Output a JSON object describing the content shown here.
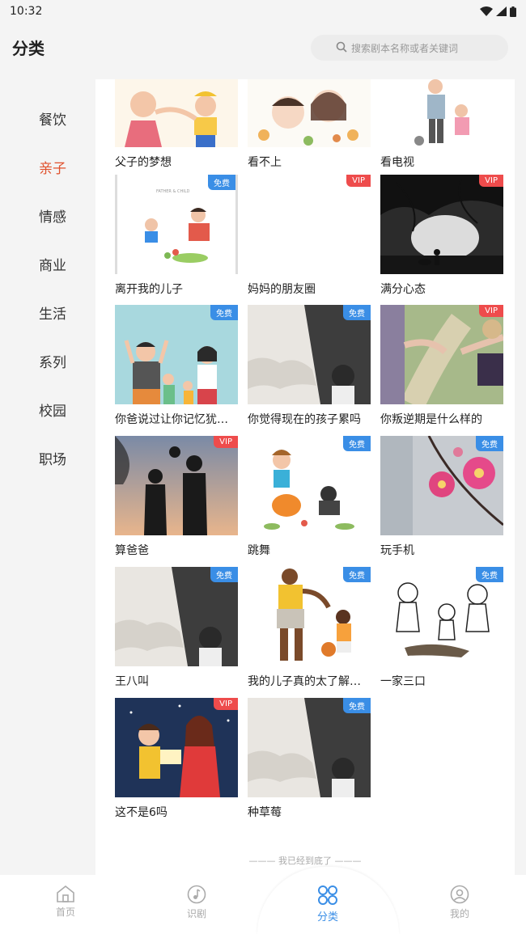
{
  "status_bar": {
    "time": "10:32"
  },
  "header": {
    "title": "分类",
    "search_placeholder": "搜索剧本名称或者关键词"
  },
  "sidebar": {
    "items": [
      {
        "label": "餐饮",
        "active": false
      },
      {
        "label": "亲子",
        "active": true
      },
      {
        "label": "情感",
        "active": false
      },
      {
        "label": "商业",
        "active": false
      },
      {
        "label": "生活",
        "active": false
      },
      {
        "label": "系列",
        "active": false
      },
      {
        "label": "校园",
        "active": false
      },
      {
        "label": "职场",
        "active": false
      }
    ]
  },
  "grid": {
    "items": [
      {
        "title": "父子的梦想",
        "badge": ""
      },
      {
        "title": "看不上",
        "badge": ""
      },
      {
        "title": "看电视",
        "badge": ""
      },
      {
        "title": "离开我的儿子",
        "badge": "免费"
      },
      {
        "title": "妈妈的朋友圈",
        "badge": "VIP"
      },
      {
        "title": "满分心态",
        "badge": "VIP"
      },
      {
        "title": "你爸说过让你记忆犹…",
        "badge": "免费"
      },
      {
        "title": "你觉得现在的孩子累吗",
        "badge": "免费"
      },
      {
        "title": "你叛逆期是什么样的",
        "badge": "VIP"
      },
      {
        "title": "算爸爸",
        "badge": "VIP"
      },
      {
        "title": "跳舞",
        "badge": "免费"
      },
      {
        "title": "玩手机",
        "badge": "免费"
      },
      {
        "title": "王八叫",
        "badge": "免费"
      },
      {
        "title": "我的儿子真的太了解…",
        "badge": "免费"
      },
      {
        "title": "一家三口",
        "badge": "免费"
      },
      {
        "title": "这不是6吗",
        "badge": "VIP"
      },
      {
        "title": "种草莓",
        "badge": "免费"
      }
    ],
    "end_text": "——— 我已经到底了 ———"
  },
  "bottom_nav": {
    "items": [
      {
        "label": "首页",
        "icon": "home-icon",
        "active": false
      },
      {
        "label": "识剧",
        "icon": "music-note-icon",
        "active": false
      },
      {
        "label": "分类",
        "icon": "category-icon",
        "active": true
      },
      {
        "label": "我的",
        "icon": "user-icon",
        "active": false
      }
    ]
  },
  "colors": {
    "accent": "#e0502c",
    "active_nav": "#3a8ee6",
    "vip": "#ee4c4c",
    "free": "#3a8ee6"
  }
}
